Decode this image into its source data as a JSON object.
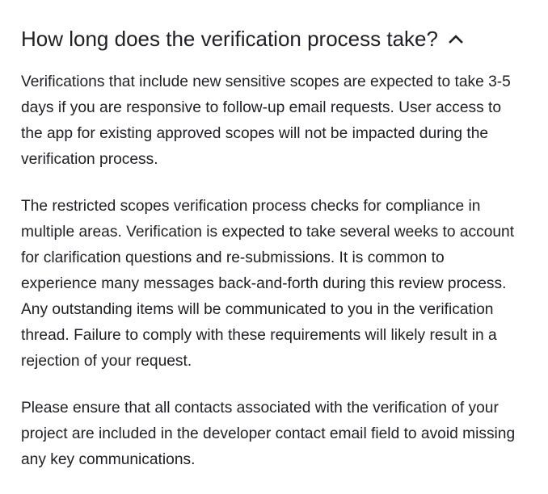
{
  "faq": {
    "question": "How long does the verification process take?",
    "expand_icon": "chevron-up-icon",
    "answer_paragraphs": [
      "Verifications that include new sensitive scopes are expected to take 3-5 days if you are responsive to follow-up email requests. User access to the app for existing approved scopes will not be impacted during the verification process.",
      "The restricted scopes verification process checks for compliance in multiple areas. Verification is expected to take several weeks to account for clarification questions and re-submissions. It is common to experience many messages back-and-forth during this review process. Any outstanding items will be communicated to you in the verification thread. Failure to comply with these requirements will likely result in a rejection of your request.",
      "Please ensure that all contacts associated with the verification of your project are included in the developer contact email field to avoid missing any key communications."
    ]
  },
  "colors": {
    "text": "#202124",
    "background": "#ffffff"
  }
}
